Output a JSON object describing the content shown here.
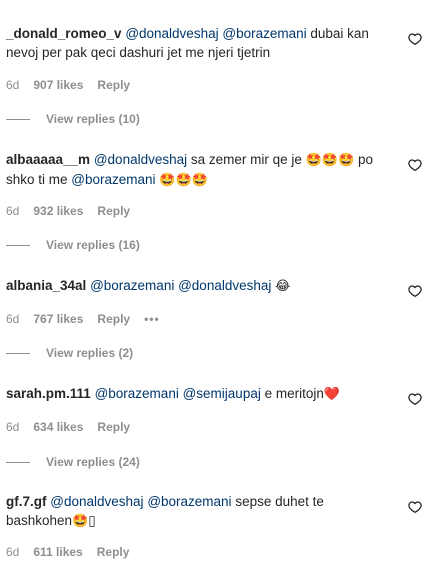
{
  "comments": [
    {
      "username": "_donald_romeo_v",
      "segments": [
        {
          "type": "mention",
          "text": "@donaldveshaj"
        },
        {
          "type": "text",
          "text": " "
        },
        {
          "type": "mention",
          "text": "@borazemani"
        },
        {
          "type": "text",
          "text": " dubai kan"
        },
        {
          "type": "br"
        },
        {
          "type": "text",
          "text": "nevoj per pak qeci dashuri jet me njeri tjetrin"
        }
      ],
      "age": "6d",
      "likes": "907 likes",
      "reply": "Reply",
      "view_replies": "View replies (10)"
    },
    {
      "username": "albaaaaa__m",
      "segments": [
        {
          "type": "mention",
          "text": "@donaldveshaj"
        },
        {
          "type": "text",
          "text": " sa zemer mir qe je "
        },
        {
          "type": "emoji",
          "text": "🤩🤩🤩"
        },
        {
          "type": "text",
          "text": "  po"
        },
        {
          "type": "br"
        },
        {
          "type": "text",
          "text": "shko ti me "
        },
        {
          "type": "mention",
          "text": "@borazemani"
        },
        {
          "type": "text",
          "text": " "
        },
        {
          "type": "emoji",
          "text": "🤩🤩🤩"
        }
      ],
      "age": "6d",
      "likes": "932 likes",
      "reply": "Reply",
      "view_replies": "View replies (16)"
    },
    {
      "username": "albania_34al",
      "segments": [
        {
          "type": "mention",
          "text": "@borazemani"
        },
        {
          "type": "text",
          "text": " "
        },
        {
          "type": "mention",
          "text": "@donaldveshaj"
        },
        {
          "type": "text",
          "text": " "
        },
        {
          "type": "emoji",
          "text": "😂"
        }
      ],
      "age": "6d",
      "likes": "767 likes",
      "reply": "Reply",
      "more": "•••",
      "view_replies": "View replies (2)"
    },
    {
      "username": "sarah.pm.111",
      "segments": [
        {
          "type": "mention",
          "text": "@borazemani"
        },
        {
          "type": "text",
          "text": " "
        },
        {
          "type": "mention",
          "text": "@semijaupaj"
        },
        {
          "type": "text",
          "text": " e meritojn"
        },
        {
          "type": "emoji",
          "text": "❤️"
        }
      ],
      "age": "6d",
      "likes": "634 likes",
      "reply": "Reply",
      "view_replies": "View replies (24)"
    },
    {
      "username": "gf.7.gf",
      "segments": [
        {
          "type": "mention",
          "text": "@donaldveshaj"
        },
        {
          "type": "text",
          "text": " "
        },
        {
          "type": "mention",
          "text": "@borazemani"
        },
        {
          "type": "text",
          "text": " sepse duhet te"
        },
        {
          "type": "br"
        },
        {
          "type": "text",
          "text": "bashkohen"
        },
        {
          "type": "emoji",
          "text": "🤩"
        },
        {
          "type": "text",
          "text": "▯"
        }
      ],
      "age": "6d",
      "likes": "611 likes",
      "reply": "Reply"
    }
  ],
  "icons": {
    "like": "heart-outline-icon",
    "more": "more-options-icon"
  },
  "colors": {
    "text": "#262626",
    "mention": "#00376b",
    "meta": "#8e8e8e",
    "heart_red": "#ed4956"
  }
}
